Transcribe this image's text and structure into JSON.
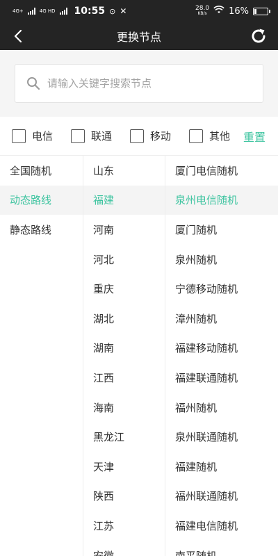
{
  "status_bar": {
    "net1": "4G+",
    "net2": "4G HD",
    "time": "10:55",
    "speed_value": "28.0",
    "speed_unit": "KB/s",
    "battery": "16%"
  },
  "header": {
    "title": "更换节点"
  },
  "search": {
    "placeholder": "请输入关键字搜索节点"
  },
  "filters": [
    {
      "label": "电信"
    },
    {
      "label": "联通"
    },
    {
      "label": "移动"
    },
    {
      "label": "其他"
    }
  ],
  "reset_label": "重置",
  "accent_color": "#3ec4a0",
  "categories": [
    {
      "label": "全国随机"
    },
    {
      "label": "动态路线"
    },
    {
      "label": "静态路线"
    }
  ],
  "selected_category": 1,
  "provinces": [
    {
      "label": "山东"
    },
    {
      "label": "福建"
    },
    {
      "label": "河南"
    },
    {
      "label": "河北"
    },
    {
      "label": "重庆"
    },
    {
      "label": "湖北"
    },
    {
      "label": "湖南"
    },
    {
      "label": "江西"
    },
    {
      "label": "海南"
    },
    {
      "label": "黑龙江"
    },
    {
      "label": "天津"
    },
    {
      "label": "陕西"
    },
    {
      "label": "江苏"
    },
    {
      "label": "安徽"
    }
  ],
  "selected_province": 1,
  "nodes": [
    {
      "label": "厦门电信随机"
    },
    {
      "label": "泉州电信随机"
    },
    {
      "label": "厦门随机"
    },
    {
      "label": "泉州随机"
    },
    {
      "label": "宁德移动随机"
    },
    {
      "label": "漳州随机"
    },
    {
      "label": "福建移动随机"
    },
    {
      "label": "福建联通随机"
    },
    {
      "label": "福州随机"
    },
    {
      "label": "泉州联通随机"
    },
    {
      "label": "福建随机"
    },
    {
      "label": "福州联通随机"
    },
    {
      "label": "福建电信随机"
    },
    {
      "label": "南平随机"
    }
  ],
  "selected_node": 1
}
